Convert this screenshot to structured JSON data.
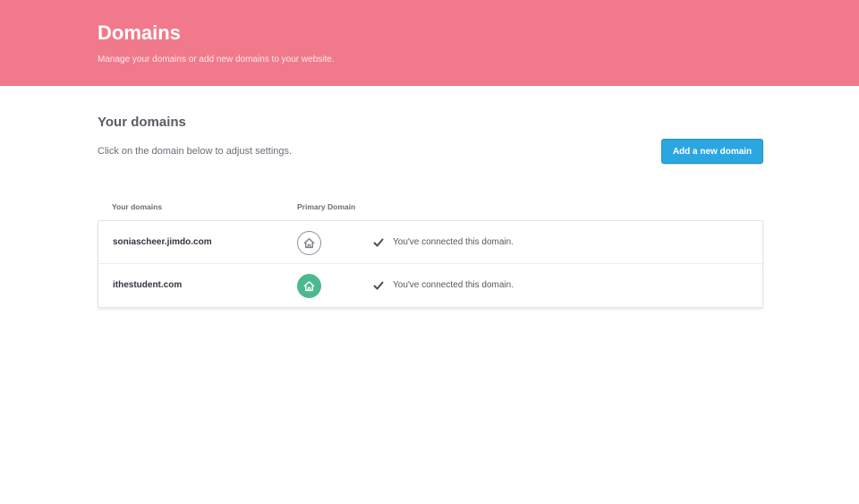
{
  "header": {
    "title": "Domains",
    "subtitle": "Manage your domains or add new domains to your website.",
    "background_color": "#f07a8c"
  },
  "section": {
    "title": "Your domains",
    "description": "Click on the domain below to adjust settings.",
    "add_button_label": "Add a new domain",
    "accent_color": "#2aa7e0"
  },
  "table": {
    "columns": [
      "Your domains",
      "Primary Domain"
    ],
    "rows": [
      {
        "domain": "soniascheer.jimdo.com",
        "is_primary": false,
        "primary_icon": "home-icon",
        "status_icon": "checkmark-icon",
        "status": "You've connected this domain."
      },
      {
        "domain": "ithestudent.com",
        "is_primary": true,
        "primary_icon": "home-icon",
        "status_icon": "checkmark-icon",
        "status": "You've connected this domain."
      }
    ],
    "primary_color": "#4bb98e"
  }
}
